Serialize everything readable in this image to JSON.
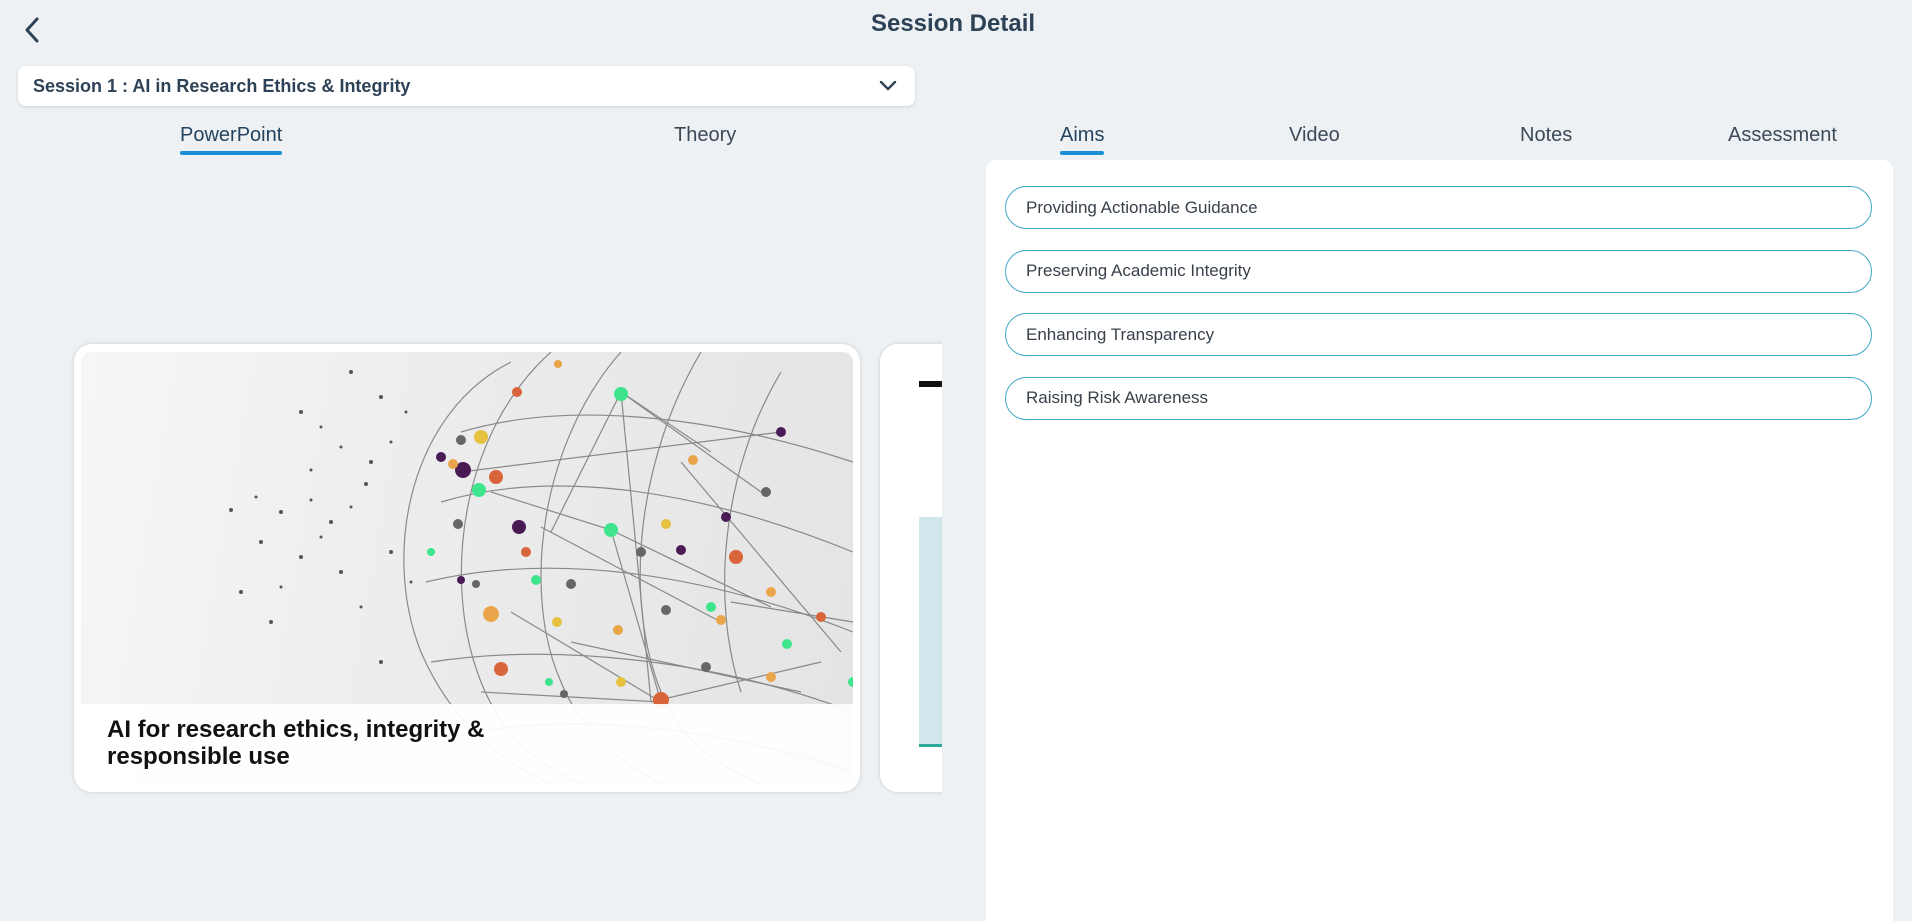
{
  "header": {
    "title": "Session Detail"
  },
  "session_select": {
    "selected": "Session 1 : AI in Research Ethics & Integrity"
  },
  "left_tabs": [
    {
      "label": "PowerPoint",
      "active": true
    },
    {
      "label": "Theory",
      "active": false
    }
  ],
  "right_tabs": [
    {
      "label": "Aims",
      "active": true
    },
    {
      "label": "Video",
      "active": false
    },
    {
      "label": "Notes",
      "active": false
    },
    {
      "label": "Assessment",
      "active": false
    }
  ],
  "slides": [
    {
      "caption": "AI for research ethics, integrity & responsible use"
    }
  ],
  "aims": [
    "Providing Actionable Guidance",
    "Preserving Academic Integrity",
    "Enhancing Transparency",
    "Raising Risk Awareness"
  ],
  "colors": {
    "accent": "#1b8fd6",
    "aim_border": "#40a8c8",
    "title": "#2d4256",
    "background": "#edf1f4"
  }
}
